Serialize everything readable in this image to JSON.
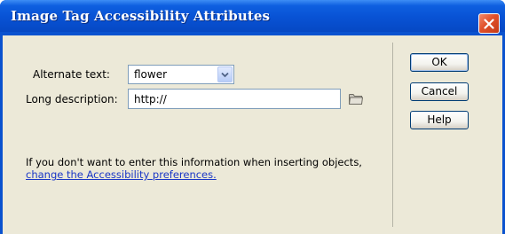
{
  "window": {
    "title": "Image Tag Accessibility Attributes"
  },
  "form": {
    "alternate_text_label": "Alternate text:",
    "alternate_text_value": "flower",
    "long_description_label": "Long description:",
    "long_description_value": "http://"
  },
  "info": {
    "message": "If you don't want to enter this information when inserting objects, ",
    "link": "change the Accessibility preferences."
  },
  "buttons": {
    "ok": "OK",
    "cancel": "Cancel",
    "help": "Help"
  },
  "colors": {
    "titlebar": "#0852d4",
    "face": "#ece9d8",
    "link": "#1a37c6",
    "close": "#e0502a"
  },
  "icons": [
    "close-icon",
    "chevron-down-icon",
    "folder-icon"
  ]
}
